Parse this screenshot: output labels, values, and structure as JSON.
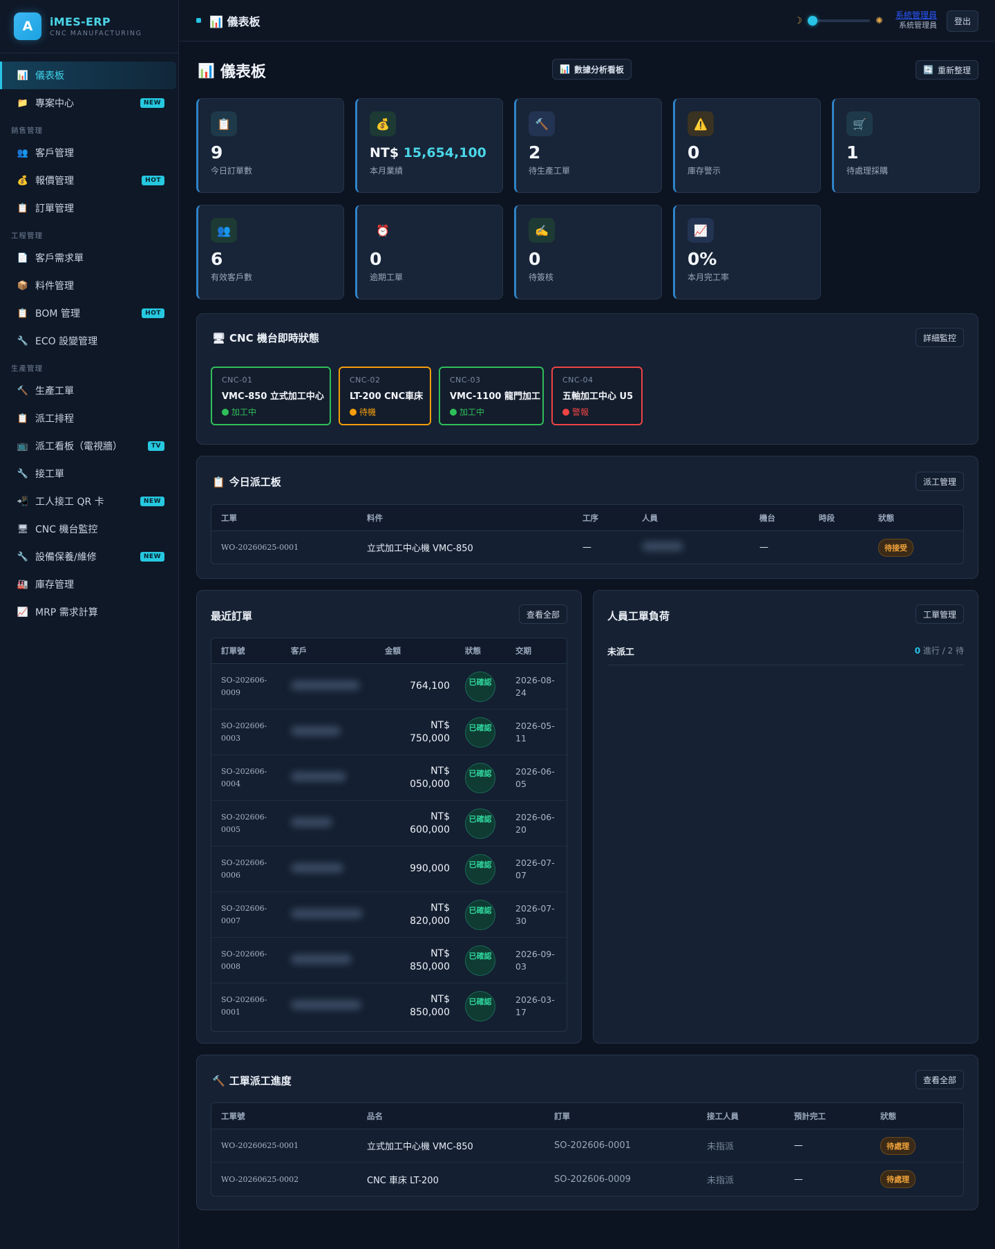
{
  "brand": {
    "logo": "A",
    "name": "iMES-ERP",
    "sub": "CNC MANUFACTURING"
  },
  "sidebar": {
    "items": [
      {
        "icon": "📊",
        "label": "儀表板",
        "badge": ""
      },
      {
        "icon": "📁",
        "label": "專案中心",
        "badge": "NEW"
      }
    ],
    "sections": [
      {
        "title": "銷售管理",
        "items": [
          {
            "icon": "👥",
            "label": "客戶管理",
            "badge": ""
          },
          {
            "icon": "💰",
            "label": "報價管理",
            "badge": "HOT"
          },
          {
            "icon": "📋",
            "label": "訂單管理",
            "badge": ""
          }
        ]
      },
      {
        "title": "工程管理",
        "items": [
          {
            "icon": "📄",
            "label": "客戶需求單",
            "badge": ""
          },
          {
            "icon": "📦",
            "label": "料件管理",
            "badge": ""
          },
          {
            "icon": "📋",
            "label": "BOM 管理",
            "badge": "HOT"
          },
          {
            "icon": "🔧",
            "label": "ECO 設變管理",
            "badge": ""
          }
        ]
      },
      {
        "title": "生產管理",
        "items": [
          {
            "icon": "🔨",
            "label": "生產工單",
            "badge": ""
          },
          {
            "icon": "📋",
            "label": "派工排程",
            "badge": ""
          },
          {
            "icon": "📺",
            "label": "派工看板（電視牆）",
            "badge": "TV"
          },
          {
            "icon": "🔧",
            "label": "接工單",
            "badge": ""
          },
          {
            "icon": "📲",
            "label": "工人接工 QR 卡",
            "badge": "NEW"
          },
          {
            "icon": "🖥",
            "label": "CNC 機台監控",
            "badge": ""
          },
          {
            "icon": "🔧",
            "label": "設備保養/維修",
            "badge": "NEW"
          },
          {
            "icon": "🏭",
            "label": "庫存管理",
            "badge": ""
          },
          {
            "icon": "📈",
            "label": "MRP 需求計算",
            "badge": ""
          }
        ]
      }
    ]
  },
  "topbar": {
    "title": "儀表板",
    "title_icon": "📊",
    "user_name": "系統管理員",
    "user_role": "系統管理員",
    "logout": "登出"
  },
  "page": {
    "title": "儀表板",
    "title_icon": "📊",
    "analysis_button": "數據分析看板",
    "refresh_button": "重新整理"
  },
  "stats": [
    {
      "icon": "📋",
      "value": "9",
      "label": "今日訂單數",
      "bg": "#1e3a4a"
    },
    {
      "icon": "💰",
      "prefix": "NT$ ",
      "value": "15,654,100",
      "label": "本月業績",
      "bg": "#1d3a35"
    },
    {
      "icon": "🔨",
      "value": "2",
      "label": "待生產工單",
      "bg": "#233352"
    },
    {
      "icon": "⚠️",
      "value": "0",
      "label": "庫存警示",
      "bg": "#3a3222"
    },
    {
      "icon": "🛒",
      "value": "1",
      "label": "待處理採購",
      "bg": "#1e3a4a"
    },
    {
      "icon": "👥",
      "value": "6",
      "label": "有效客戶數",
      "bg": "#1d3a35"
    },
    {
      "icon": "⏰",
      "value": "0",
      "label": "逾期工單",
      "bg": "#182437"
    },
    {
      "icon": "✍️",
      "value": "0",
      "label": "待簽核",
      "bg": "#1d3a35"
    },
    {
      "icon": "📈",
      "value": "0%",
      "label": "本月完工率",
      "bg": "#233352"
    }
  ],
  "cnc": {
    "title": "CNC 機台即時狀態",
    "title_icon": "🖥",
    "button": "詳細監控",
    "machines": [
      {
        "id": "CNC-01",
        "name": "VMC-850 立式加工中心",
        "status": "加工中",
        "color": "#2fbf5a"
      },
      {
        "id": "CNC-02",
        "name": "LT-200 CNC車床",
        "status": "待機",
        "color": "#f59e0b"
      },
      {
        "id": "CNC-03",
        "name": "VMC-1100 龍門加工",
        "status": "加工中",
        "color": "#2fbf5a"
      },
      {
        "id": "CNC-04",
        "name": "五軸加工中心 U5",
        "status": "警報",
        "color": "#ef4444"
      }
    ]
  },
  "dispatch": {
    "title": "今日派工板",
    "title_icon": "📋",
    "button": "派工管理",
    "columns": [
      "工單",
      "料件",
      "工序",
      "人員",
      "機台",
      "時段",
      "狀態"
    ],
    "rows": [
      {
        "wo": "WO-20260625-0001",
        "part": "立式加工中心機 VMC-850",
        "process": "—",
        "machine": "—",
        "slot": "",
        "status": "待接受"
      }
    ]
  },
  "orders": {
    "title": "最近訂單",
    "button": "查看全部",
    "columns": [
      "訂單號",
      "客戶",
      "金額",
      "狀態",
      "交期"
    ],
    "rows": [
      {
        "no1": "SO-202606-",
        "no2": "0009",
        "amt1": "",
        "amt2": "764,100",
        "status": "已確認",
        "d1": "2026-08-",
        "d2": "24"
      },
      {
        "no1": "SO-202606-",
        "no2": "0003",
        "amt1": "NT$",
        "amt2": "750,000",
        "status": "已確認",
        "d1": "2026-05-",
        "d2": "11"
      },
      {
        "no1": "SO-202606-",
        "no2": "0004",
        "amt1": "NT$",
        "amt2": "050,000",
        "status": "已確認",
        "d1": "2026-06-",
        "d2": "05"
      },
      {
        "no1": "SO-202606-",
        "no2": "0005",
        "amt1": "NT$",
        "amt2": "600,000",
        "status": "已確認",
        "d1": "2026-06-",
        "d2": "20"
      },
      {
        "no1": "SO-202606-",
        "no2": "0006",
        "amt1": "",
        "amt2": "990,000",
        "status": "已確認",
        "d1": "2026-07-",
        "d2": "07"
      },
      {
        "no1": "SO-202606-",
        "no2": "0007",
        "amt1": "NT$",
        "amt2": "820,000",
        "status": "已確認",
        "d1": "2026-07-",
        "d2": "30"
      },
      {
        "no1": "SO-202606-",
        "no2": "0008",
        "amt1": "NT$",
        "amt2": "850,000",
        "status": "已確認",
        "d1": "2026-09-",
        "d2": "03"
      },
      {
        "no1": "SO-202606-",
        "no2": "0001",
        "amt1": "NT$",
        "amt2": "850,000",
        "status": "已確認",
        "d1": "2026-03-",
        "d2": "17"
      }
    ]
  },
  "workload": {
    "title": "人員工單負荷",
    "button": "工單管理",
    "rows": [
      {
        "name": "未派工",
        "active": "0",
        "rest": " 進行 / 2 待"
      }
    ]
  },
  "progress": {
    "title": "工單派工進度",
    "title_icon": "🔨",
    "button": "查看全部",
    "columns": [
      "工單號",
      "品名",
      "訂單",
      "接工人員",
      "預計完工",
      "狀態"
    ],
    "rows": [
      {
        "wo": "WO-20260625-0001",
        "name": "立式加工中心機 VMC-850",
        "order": "SO-202606-0001",
        "worker": "未指派",
        "eta": "—",
        "status": "待處理"
      },
      {
        "wo": "WO-20260625-0002",
        "name": "CNC 車床 LT-200",
        "order": "SO-202606-0009",
        "worker": "未指派",
        "eta": "—",
        "status": "待處理"
      }
    ]
  }
}
